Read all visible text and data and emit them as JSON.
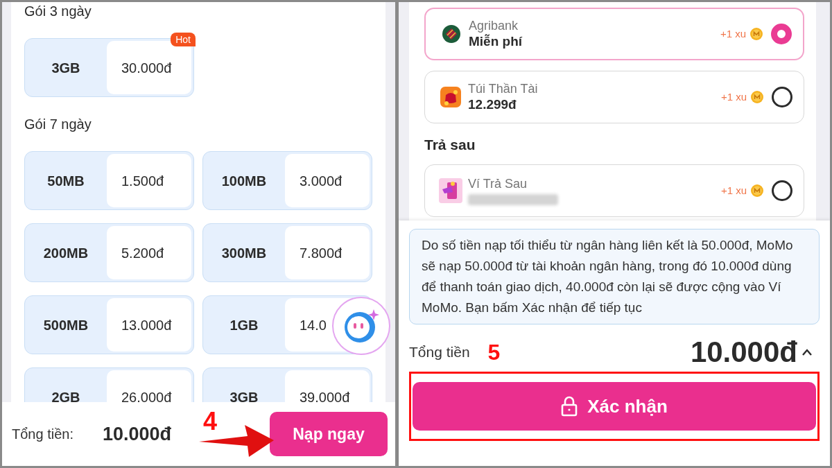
{
  "left": {
    "sections": [
      {
        "title": "Gói 3 ngày",
        "packages": [
          {
            "size": "3GB",
            "price": "30.000đ",
            "badge": "Hot"
          }
        ]
      },
      {
        "title": "Gói 7 ngày",
        "packages": [
          {
            "size": "50MB",
            "price": "1.500đ"
          },
          {
            "size": "100MB",
            "price": "3.000đ"
          },
          {
            "size": "200MB",
            "price": "5.200đ"
          },
          {
            "size": "300MB",
            "price": "7.800đ"
          },
          {
            "size": "500MB",
            "price": "13.000đ"
          },
          {
            "size": "1GB",
            "price": "14.0"
          },
          {
            "size": "2GB",
            "price": "26.000đ"
          },
          {
            "size": "3GB",
            "price": "39.000đ"
          }
        ]
      }
    ],
    "footer": {
      "total_label": "Tổng tiền:",
      "total": "10.000đ",
      "button": "Nạp ngay"
    },
    "step": "4"
  },
  "right": {
    "groups": [
      {
        "items": [
          {
            "kind": "bank",
            "name": "Agribank",
            "detail": "Miễn phí",
            "reward": "+1 xu",
            "selected": true
          },
          {
            "kind": "wallet",
            "name": "Túi Thần Tài",
            "detail": "12.299đ",
            "reward": "+1 xu",
            "selected": false
          }
        ]
      },
      {
        "title": "Trả sau",
        "items": [
          {
            "kind": "paylater",
            "name": "Ví Trả Sau",
            "reward": "+1 xu",
            "selected": false
          }
        ]
      }
    ],
    "notice": "Do số tiền nạp tối thiểu từ ngân hàng liên kết là 50.000đ, MoMo sẽ nạp 50.000đ từ tài khoản ngân hàng, trong đó 10.000đ dùng để thanh toán giao dịch, 40.000đ còn lại sẽ được cộng vào Ví MoMo. Bạn bấm Xác nhận để tiếp tục",
    "total_label": "Tổng tiền",
    "step": "5",
    "total": "10.000đ",
    "button": "Xác nhận"
  }
}
